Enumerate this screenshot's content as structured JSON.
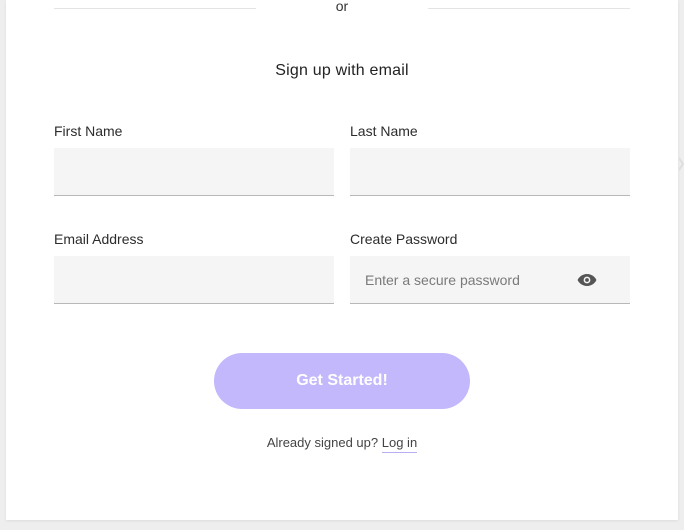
{
  "divider": {
    "text": "or"
  },
  "signup": {
    "heading": "Sign up with email",
    "first_name": {
      "label": "First Name",
      "value": "",
      "placeholder": ""
    },
    "last_name": {
      "label": "Last Name",
      "value": "",
      "placeholder": ""
    },
    "email": {
      "label": "Email Address",
      "value": "",
      "placeholder": ""
    },
    "password": {
      "label": "Create Password",
      "value": "",
      "placeholder": "Enter a secure password",
      "toggle_icon": "eye-icon"
    },
    "submit_label": "Get Started!",
    "already_text": "Already signed up?",
    "login_link": "Log in"
  },
  "colors": {
    "accent": "#c3b8fb",
    "input_bg": "#f5f5f5",
    "page_bg": "#eeeeef"
  }
}
